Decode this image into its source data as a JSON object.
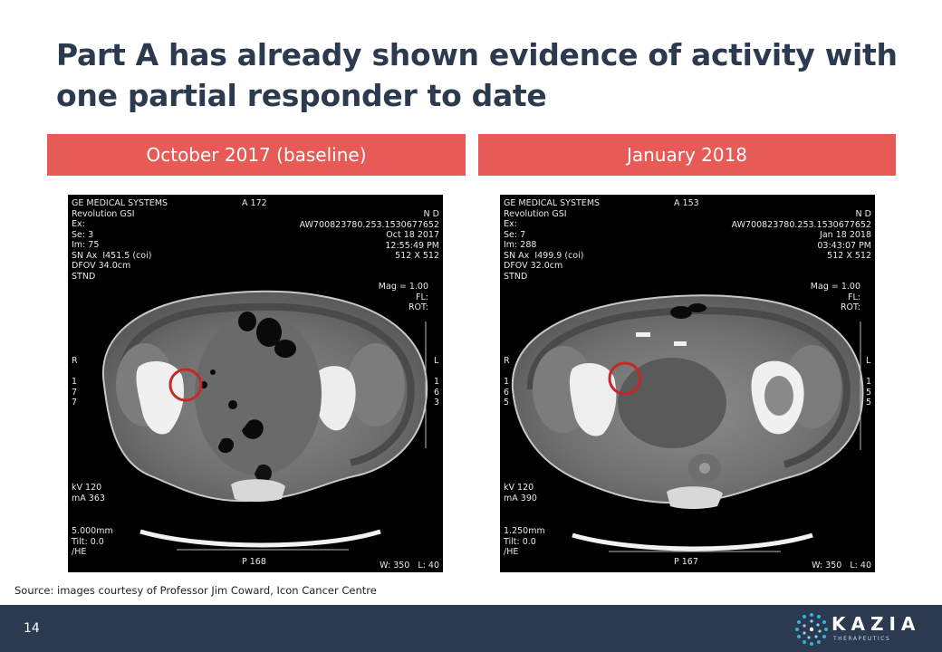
{
  "slide": {
    "title": "Part A has already shown evidence of activity with one partial responder to date",
    "source": "Source: images courtesy of Professor Jim Coward, Icon Cancer Centre",
    "page_number": "14"
  },
  "panels": [
    {
      "label": "October 2017 (baseline)",
      "overlay": {
        "top_left": "GE MEDICAL SYSTEMS\nRevolution GSI\nEx:\nSe: 3\nIm: 75\nSN Ax  I451.5 (coi)\nDFOV 34.0cm\nSTND",
        "top_center": "A 172",
        "top_right": "N D\nAW700823780.253.1530677652\nOct 18 2017\n12:55:49 PM\n512 X 512",
        "mag": "Mag = 1.00\nFL:\nROT:",
        "left_side": "R\n \n1\n7\n7",
        "right_side": "L\n \n1\n6\n3",
        "bottom_left_1": "kV 120\nmA 363",
        "bottom_left_2": "5.000mm\nTilt: 0.0\n/HE",
        "bottom_center": "P 168",
        "bottom_right": "W: 350   L: 40"
      }
    },
    {
      "label": "January 2018",
      "overlay": {
        "top_left": "GE MEDICAL SYSTEMS\nRevolution GSI\nEx:\nSe: 7\nIm: 288\nSN Ax  I499.9 (coi)\nDFOV 32.0cm\nSTND",
        "top_center": "A 153",
        "top_right": "N D\nAW700823780.253.1530677652\nJan 18 2018\n03:43:07 PM\n512 X 512",
        "mag": "Mag = 1.00\nFL:\nROT:",
        "left_side": "R\n \n1\n6\n5",
        "right_side": "L\n \n1\n5\n5",
        "bottom_left_1": "kV 120\nmA 390",
        "bottom_left_2": "1.250mm\nTilt: 0.0\n/HE",
        "bottom_center": "P 167",
        "bottom_right": "W: 350   L: 40"
      }
    }
  ],
  "logo": {
    "word": "KAZIA",
    "sub": "THERAPEUTICS"
  },
  "colors": {
    "navy": "#2b3a4f",
    "banner": "#e85a55",
    "marker": "#c62828"
  }
}
